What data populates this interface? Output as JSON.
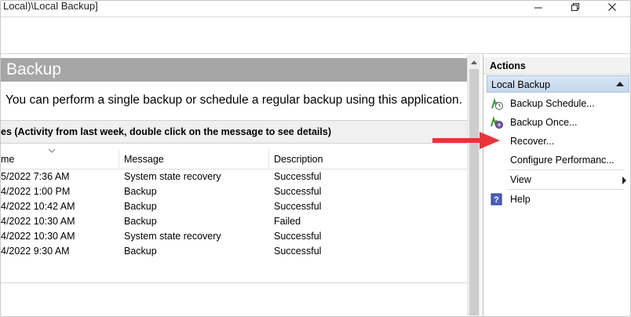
{
  "window": {
    "title": "Local)\\Local Backup]",
    "controls": {
      "minimize": "minimize-icon",
      "maximize": "maximize-icon",
      "close": "close-icon"
    }
  },
  "main": {
    "banner_title": "Backup",
    "intro_text": "You can perform a single backup or schedule a regular backup using this application.",
    "section_title": "es (Activity from last week, double click on the message to see details)",
    "table": {
      "columns": [
        "me",
        "Message",
        "Description"
      ],
      "rows": [
        {
          "time": "5/2022 7:36 AM",
          "message": "System state recovery",
          "description": "Successful"
        },
        {
          "time": "4/2022 1:00 PM",
          "message": "Backup",
          "description": "Successful"
        },
        {
          "time": "4/2022 10:42 AM",
          "message": "Backup",
          "description": "Successful"
        },
        {
          "time": "4/2022 10:30 AM",
          "message": "Backup",
          "description": "Failed"
        },
        {
          "time": "4/2022 10:30 AM",
          "message": "System state recovery",
          "description": "Successful"
        },
        {
          "time": "4/2022 9:30 AM",
          "message": "Backup",
          "description": "Successful"
        }
      ]
    }
  },
  "actions": {
    "header": "Actions",
    "group": "Local Backup",
    "items": [
      {
        "label": "Backup Schedule...",
        "icon": "backup-schedule-icon"
      },
      {
        "label": "Backup Once...",
        "icon": "backup-once-icon"
      },
      {
        "label": "Recover...",
        "icon": "none"
      },
      {
        "label": "Configure Performanc...",
        "icon": "none"
      },
      {
        "label": "View",
        "icon": "none",
        "submenu": true
      },
      {
        "label": "Help",
        "icon": "help-icon"
      }
    ]
  },
  "colors": {
    "banner_bg": "#a6a6a6",
    "group_bg": "#c9dcf0",
    "annotation_arrow": "#e8343a"
  }
}
